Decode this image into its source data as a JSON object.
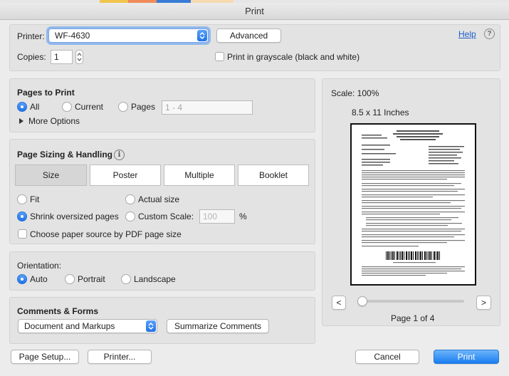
{
  "window": {
    "title": "Print"
  },
  "printer_row": {
    "printer_label": "Printer:",
    "printer_value": "WF-4630",
    "advanced_label": "Advanced",
    "help_label": "Help",
    "copies_label": "Copies:",
    "copies_value": "1",
    "grayscale_label": "Print in grayscale (black and white)"
  },
  "pages_to_print": {
    "heading": "Pages to Print",
    "all_label": "All",
    "current_label": "Current",
    "pages_label": "Pages",
    "pages_placeholder": "1 - 4",
    "more_options_label": "More Options",
    "selected": "All"
  },
  "sizing": {
    "heading": "Page Sizing & Handling",
    "segments": [
      "Size",
      "Poster",
      "Multiple",
      "Booklet"
    ],
    "selected_segment": "Size",
    "fit_label": "Fit",
    "actual_size_label": "Actual size",
    "shrink_label": "Shrink oversized pages",
    "custom_scale_label": "Custom Scale:",
    "custom_scale_value": "100",
    "percent": "%",
    "pdf_source_label": "Choose paper source by PDF page size",
    "selected_option": "Shrink oversized pages"
  },
  "orientation": {
    "heading": "Orientation:",
    "auto_label": "Auto",
    "portrait_label": "Portrait",
    "landscape_label": "Landscape",
    "selected": "Auto"
  },
  "comments": {
    "heading": "Comments & Forms",
    "select_value": "Document and Markups",
    "summarize_label": "Summarize Comments"
  },
  "preview": {
    "scale_label": "Scale: 100%",
    "paper_size": "8.5 x 11 Inches",
    "prev_label": "<",
    "next_label": ">",
    "page_indicator": "Page 1 of 4",
    "current_page": 1,
    "total_pages": 4
  },
  "footer": {
    "page_setup_label": "Page Setup...",
    "printer_label": "Printer...",
    "cancel_label": "Cancel",
    "print_label": "Print"
  },
  "colors": {
    "accent": "#1a7ef0",
    "link": "#1e5cc8",
    "panel": "#e3e3e3"
  }
}
